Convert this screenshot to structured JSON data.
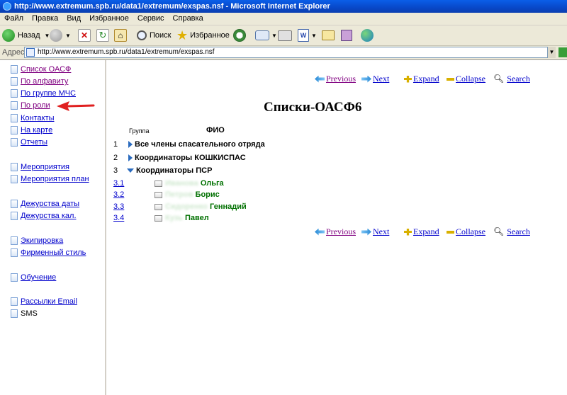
{
  "window": {
    "title": "http://www.extremum.spb.ru/data1/extremum/exspas.nsf - Microsoft Internet Explorer"
  },
  "menu": {
    "items": [
      "Файл",
      "Правка",
      "Вид",
      "Избранное",
      "Сервис",
      "Справка"
    ]
  },
  "toolbar": {
    "back_label": "Назад",
    "search_label": "Поиск",
    "favorites_label": "Избранное"
  },
  "address": {
    "label": "Адрес:",
    "url": "http://www.extremum.spb.ru/data1/extremum/exspas.nsf"
  },
  "nav": {
    "items": [
      {
        "label": "Список ОАСФ",
        "visited": true
      },
      {
        "label": "По алфавиту",
        "visited": true
      },
      {
        "label": "По группе МЧС",
        "visited": false
      },
      {
        "label": "По роли",
        "visited": true
      },
      {
        "label": "Контакты",
        "visited": false
      },
      {
        "label": "На карте",
        "visited": false
      },
      {
        "label": "Отчеты",
        "visited": false
      },
      {
        "label": "Мероприятия",
        "visited": false
      },
      {
        "label": "Мероприятия план",
        "visited": false
      },
      {
        "label": "Дежурства даты",
        "visited": false
      },
      {
        "label": "Дежурства кал.",
        "visited": false
      },
      {
        "label": "Экипировка",
        "visited": false
      },
      {
        "label": "Фирменный стиль",
        "visited": false
      },
      {
        "label": "Обучение",
        "visited": false
      },
      {
        "label": "Рассылки Email",
        "visited": false
      },
      {
        "label": "SMS",
        "visited": false
      }
    ]
  },
  "actions": {
    "previous": "Previous",
    "next": "Next",
    "expand": "Expand",
    "collapse": "Collapse",
    "search": "Search"
  },
  "view": {
    "title": "Списки-ОАСФ6",
    "col_group": "Группа",
    "col_fio": "ФИО",
    "categories": [
      {
        "num": "1",
        "label": "Все члены спасательного отряда",
        "expanded": false
      },
      {
        "num": "2",
        "label": "Координаторы КОШКИСПАС",
        "expanded": false
      },
      {
        "num": "3",
        "label": "Координаторы ПСР",
        "expanded": true
      }
    ],
    "entries": [
      {
        "num": "3.1",
        "hidden": "Иванова",
        "name": "Ольга"
      },
      {
        "num": "3.2",
        "hidden": "Петров",
        "name": "Борис"
      },
      {
        "num": "3.3",
        "hidden": "Сидоренко",
        "name": "Геннадий"
      },
      {
        "num": "3.4",
        "hidden": "Кузь",
        "name": "Павел"
      }
    ]
  },
  "colors": {
    "link": "#0000cc",
    "visited": "#800080",
    "person": "#007000",
    "arrow": "#e02020"
  }
}
